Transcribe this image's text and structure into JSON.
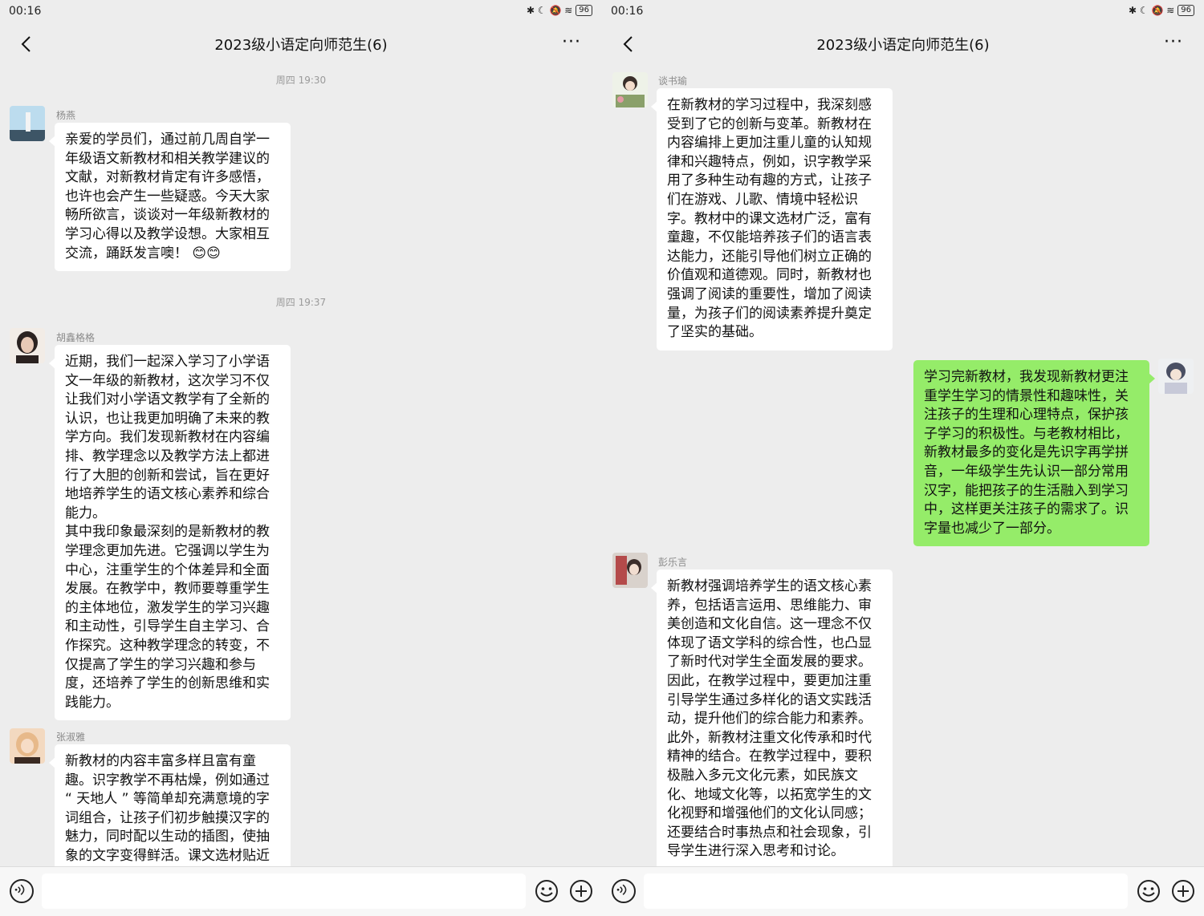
{
  "status": {
    "time": "00:16",
    "battery": "96",
    "icons": "✱ ☾ 🔕 ≋"
  },
  "header": {
    "title": "2023级小语定向师范生(6)"
  },
  "left": {
    "timestamps": [
      "周四 19:30",
      "周四 19:37"
    ],
    "messages": [
      {
        "sender": "杨燕",
        "avatar_colors": [
          "#b7d8ea",
          "#2a3a4a"
        ],
        "text": "亲爱的学员们，通过前几周自学一\n年级语文新教材和相关教学建议的\n文献，对新教材肯定有许多感悟，\n也许也会产生一些疑惑。今天大家\n畅所欲言，谈谈对一年级新教材的\n学习心得以及教学设想。大家相互\n交流，踊跃发言噢！ 😊😊"
      },
      {
        "sender": "胡鑫格格",
        "avatar_colors": [
          "#f2ece6",
          "#2b2220"
        ],
        "text": "近期，我们一起深入学习了小学语\n文一年级的新教材，这次学习不仅\n让我们对小学语文教学有了全新的\n认识，也让我更加明确了未来的教\n学方向。我们发现新教材在内容编\n排、教学理念以及教学方法上都进\n行了大胆的创新和尝试，旨在更好\n地培养学生的语文核心素养和综合\n能力。\n其中我印象最深刻的是新教材的教\n学理念更加先进。它强调以学生为\n中心，注重学生的个体差异和全面\n发展。在教学中，教师要尊重学生\n的主体地位，激发学生的学习兴趣\n和主动性，引导学生自主学习、合\n作探究。这种教学理念的转变，不\n仅提高了学生的学习兴趣和参与\n度，还培养了学生的创新思维和实\n践能力。"
      },
      {
        "sender": "张淑雅",
        "avatar_colors": [
          "#f0c9a8",
          "#3a2a22"
        ],
        "text": "新教材的内容丰富多样且富有童\n趣。识字教学不再枯燥，例如通过\n“ 天地人 ” 等简单却充满意境的字\n词组合，让孩子们初步触摸汉字的\n魅力，同时配以生动的插图，使抽\n象的文字变得鲜活。课文选材贴近"
      }
    ]
  },
  "right": {
    "messages": [
      {
        "sender": "谈书瑜",
        "avatar_colors": [
          "#e9efe2",
          "#6b7b4a"
        ],
        "text": "在新教材的学习过程中，我深刻感\n受到了它的创新与变革。新教材在\n内容编排上更加注重儿童的认知规\n律和兴趣特点，例如，识字教学采\n用了多种生动有趣的方式，让孩子\n们在游戏、儿歌、情境中轻松识\n字。教材中的课文选材广泛，富有\n童趣，不仅能培养孩子们的语言表\n达能力，还能引导他们树立正确的\n价值观和道德观。同时，新教材也\n强调了阅读的重要性，增加了阅读\n量，为孩子们的阅读素养提升奠定\n了坚实的基础。"
      },
      {
        "sender": "",
        "mine": true,
        "avatar_colors": [
          "#eef0f2",
          "#4a4f63"
        ],
        "text": "学习完新教材，我发现新教材更注\n重学生学习的情景性和趣味性，关\n注孩子的生理和心理特点，保护孩\n子学习的积极性。与老教材相比，\n新教材最多的变化是先识字再学拼\n音，一年级学生先认识一部分常用\n汉字，能把孩子的生活融入到学习\n中，这样更关注孩子的需求了。识\n字量也减少了一部分。"
      },
      {
        "sender": "彭乐言",
        "avatar_colors": [
          "#d9d2cc",
          "#3b2d2a"
        ],
        "text": "新教材强调培养学生的语文核心素\n养，包括语言运用、思维能力、审\n美创造和文化自信。这一理念不仅\n体现了语文学科的综合性，也凸显\n了新时代对学生全面发展的要求。\n因此，在教学过程中，要更加注重\n引导学生通过多样化的语文实践活\n动，提升他们的综合能力和素养。\n此外，新教材注重文化传承和时代\n精神的结合。在教学过程中，要积\n极融入多元文化元素，如民族文\n化、地域文化等，以拓宽学生的文\n化视野和增强他们的文化认同感；\n还要结合时事热点和社会现象，引\n导学生进行深入思考和讨论。"
      }
    ]
  }
}
